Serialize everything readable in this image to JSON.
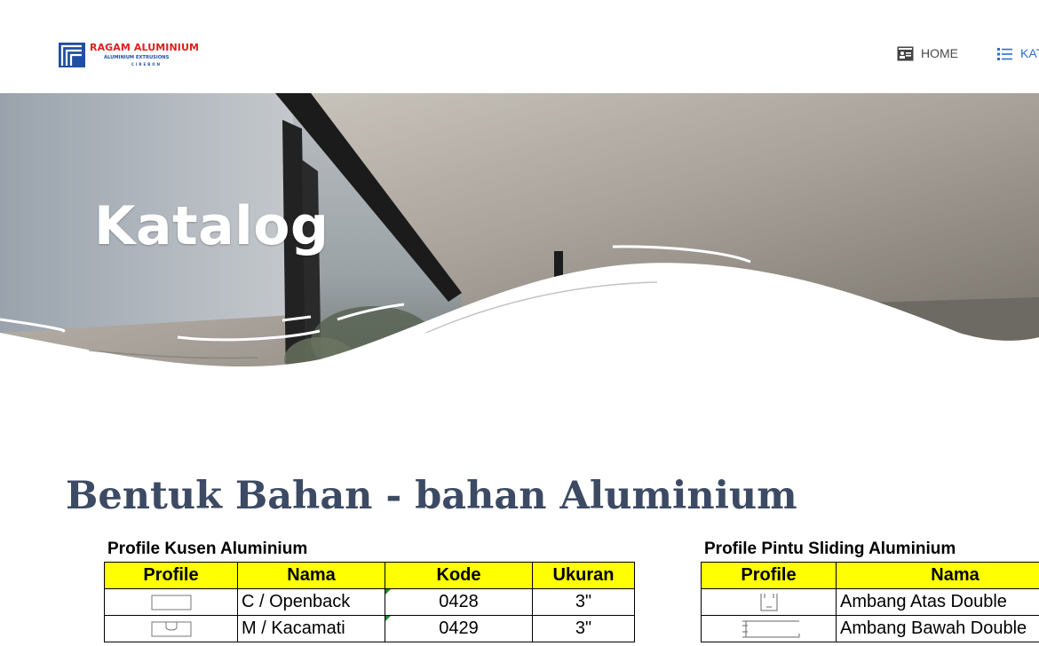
{
  "brand": {
    "title": "RAGAM ALUMINIUM",
    "subtitle": "ALUMINIUM EXTRUSIONS",
    "city": "CIREBON",
    "colors": {
      "red": "#e0201b",
      "blue": "#1f4fa3"
    }
  },
  "nav": {
    "items": [
      {
        "label": "HOME",
        "icon": "id-card-icon",
        "active": false
      },
      {
        "label": "KATALOG",
        "icon": "list-icon",
        "active": true
      }
    ],
    "active_color": "#2d6fd0"
  },
  "hero": {
    "title": "Katalog"
  },
  "main": {
    "heading": "Bentuk Bahan - bahan Aluminium",
    "tables": [
      {
        "caption": "Profile Kusen Aluminium",
        "headers": [
          "Profile",
          "Nama",
          "Kode",
          "Ukuran"
        ],
        "rows": [
          {
            "profile_icon": "c-openback-profile-icon",
            "nama": "C / Openback",
            "kode": "0428",
            "ukuran": "3\""
          },
          {
            "profile_icon": "m-kacamati-profile-icon",
            "nama": "M / Kacamati",
            "kode": "0429",
            "ukuran": "3\""
          }
        ]
      },
      {
        "caption": "Profile Pintu Sliding Aluminium",
        "headers": [
          "Profile",
          "Nama"
        ],
        "rows": [
          {
            "profile_icon": "ambang-atas-profile-icon",
            "nama": "Ambang Atas Double"
          },
          {
            "profile_icon": "ambang-bawah-profile-icon",
            "nama": "Ambang Bawah Double"
          }
        ]
      }
    ],
    "header_fill": "#ffff00"
  }
}
